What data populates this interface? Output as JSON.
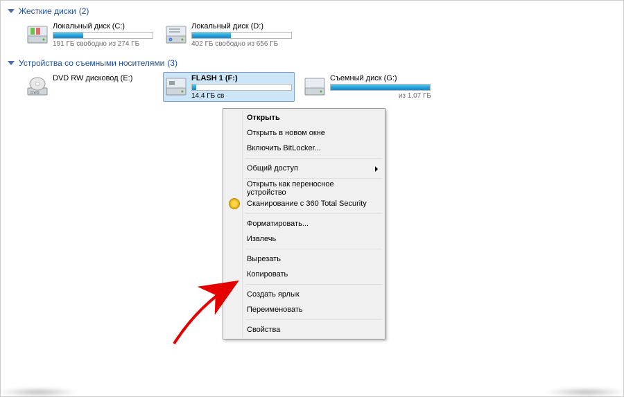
{
  "groups": {
    "hdd": {
      "title": "Жесткие диски",
      "count": "(2)"
    },
    "removable": {
      "title": "Устройства со съемными носителями",
      "count": "(3)"
    }
  },
  "drives": {
    "c": {
      "name": "Локальный диск (C:)",
      "capacity": "191 ГБ свободно из 274 ГБ",
      "fill_pct": 30
    },
    "d": {
      "name": "Локальный диск (D:)",
      "capacity": "402 ГБ свободно из 656 ГБ",
      "fill_pct": 39
    },
    "e": {
      "name": "DVD RW дисковод (E:)"
    },
    "f": {
      "name": "FLASH 1 (F:)",
      "capacity": "14,4 ГБ св",
      "fill_pct": 4
    },
    "g": {
      "name": "Съемный диск (G:)",
      "capacity": "из 1,07 ГБ",
      "fill_pct": 100
    }
  },
  "menu": {
    "open": "Открыть",
    "open_new": "Открыть в новом окне",
    "bitlocker": "Включить BitLocker...",
    "share": "Общий доступ",
    "portable": "Открыть как переносное устройство",
    "scan": "Сканирование с 360 Total Security",
    "format": "Форматировать...",
    "eject": "Извлечь",
    "cut": "Вырезать",
    "copy": "Копировать",
    "shortcut": "Создать ярлык",
    "rename": "Переименовать",
    "properties": "Свойства"
  }
}
